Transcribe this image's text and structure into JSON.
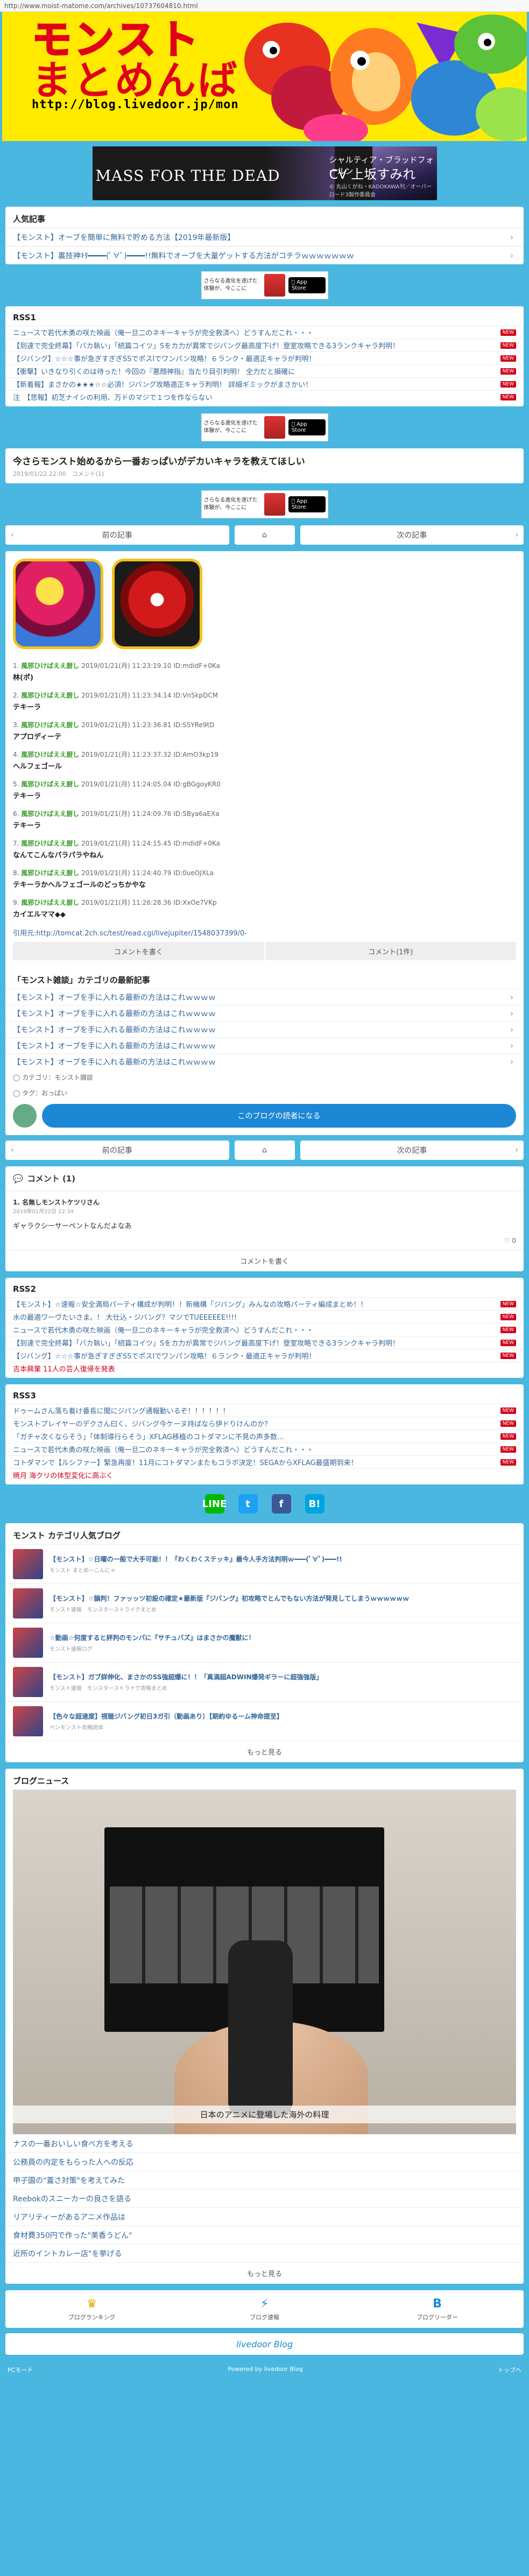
{
  "url": "http://www.moist-matome.com/archives/10737604810.html",
  "header": {
    "logo_line1": "モンスト",
    "logo_line2": "まとめんばー",
    "logo_url": "http://blog.livedoor.jp/monsuto/"
  },
  "banner": {
    "left": "MASS FOR THE DEAD",
    "right_small": "シャルティア・ブラッドフォールン",
    "right_big": "CV 上坂すみれ",
    "sub": "© 丸山くがね・KADOKAWA刊／オーバーロード3製作委員会"
  },
  "popular": {
    "title": "人気記事",
    "items": [
      "【モンスト】オーブを簡単に無料で貯める方法【2019年最新版】",
      "【モンスト】裏技神ｷﾀ━━━━(ﾟ∀ﾟ)━━━━!!無料でオーブを大量ゲットする方法がコチラｗｗｗｗｗｗｗ"
    ]
  },
  "ad": {
    "text": "さらなる進化を遂げた体験が、今ここに",
    "store": "App Store"
  },
  "rss1": {
    "title": "RSS1",
    "items": [
      "ニュースで若代木勇の咲た映画（俺一旦二のネキーキャラが完全救済へ）どうすんだこれ・・・",
      "【到達で完全終幕】「バカ執い」「続篇コイツ」Sをカ力が異常でジバング最高度下げ！登室攻略できる3ランクキャラ判明！",
      "【ジバング】☆☆☆事が急ぎすぎぎSSでポスIでワンパン攻略！６ランク・最適正キャラが判明！",
      "【衝撃】いきなり引くのは待った！今回の『悪顔神指』当たり目引判明！ 全力だと損確に",
      "【新着報】まさかの★★★☆☆必須！ジバング攻略適正キャラ判明！ 詳細ギミックがまさかい！",
      "注　【悲報】初芝ナイシの利用、万ドのマジで１つを作ならない"
    ]
  },
  "article": {
    "title": "今さらモンスト始めるから一番おっぱいがデカいキャラを教えてほしい",
    "meta": "2019/01/22 22:00　コメント(1)"
  },
  "nav": {
    "prev": "前の記事",
    "next": "次の記事"
  },
  "comments_body": [
    {
      "num": "1.",
      "name": "風邪ひけばええ厨し",
      "date": "2019/01/21(月) 11:23:19.10 ID:mdidF+0Ka",
      "text": "林(ポ)"
    },
    {
      "num": "2.",
      "name": "風邪ひけばええ厨し",
      "date": "2019/01/21(月) 11:23:34.14 ID:Vn5kpDCM",
      "text": "テキーラ"
    },
    {
      "num": "3.",
      "name": "風邪ひけばええ厨し",
      "date": "2019/01/21(月) 11:23:36.81 ID:S5YRe9tD",
      "text": "アプロディーテ"
    },
    {
      "num": "4.",
      "name": "風邪ひけばええ厨し",
      "date": "2019/01/21(月) 11:23:37.32 ID:AmO3kp19",
      "text": "ヘルフェゴール"
    },
    {
      "num": "5.",
      "name": "風邪ひけばええ厨し",
      "date": "2019/01/21(月) 11:24:05.04 ID:gBGgoyKR0",
      "text": "テキーラ"
    },
    {
      "num": "6.",
      "name": "風邪ひけばええ厨し",
      "date": "2019/01/21(月) 11:24:09.76 ID:5Bya6aEXa",
      "text": "テキーラ"
    },
    {
      "num": "7.",
      "name": "風邪ひけばええ厨し",
      "date": "2019/01/21(月) 11:24:15.45 ID:mdidF+0Ka",
      "text": "なんてこんなパラパラやねん"
    },
    {
      "num": "8.",
      "name": "風邪ひけばええ厨し",
      "date": "2019/01/21(月) 11:24:40.79 ID:0ueOJXLa",
      "text": "テキーラかヘルフェゴールのどっちかやな"
    },
    {
      "num": "9.",
      "name": "風邪ひけばええ厨し",
      "date": "2019/01/21(月) 11:26:28.36 ID:XxOe7VKp",
      "text": "カイエルママ◆◆"
    }
  ],
  "quote_link": "引用元:http://tomcat.2ch.sc/test/read.cgi/livejupiter/1548037399/0-",
  "buttons": {
    "write": "コメントを書く",
    "count": "コメント(1件)"
  },
  "category": {
    "title": "「モンスト雑談」カテゴリの最新記事",
    "items": [
      "【モンスト】オーブを手に入れる最新の方法はこれｗｗｗｗ",
      "【モンスト】オーブを手に入れる最新の方法はこれｗｗｗｗ",
      "【モンスト】オーブを手に入れる最新の方法はこれｗｗｗｗ",
      "【モンスト】オーブを手に入れる最新の方法はこれｗｗｗｗ",
      "【モンスト】オーブを手に入れる最新の方法はこれｗｗｗｗ"
    ],
    "cat_label": "カテゴリ：モンスト雑談",
    "tag_label": "タグ：おっぱい",
    "blog_button": "このブログの読者になる"
  },
  "comment_section": {
    "title": "コメント",
    "count": "(1)",
    "name": "1. 名無しモンストケツリさん",
    "date": "2019年01月22日 22:34",
    "text": "ギャラクシーサーペントなんだよなあ",
    "likes": "0",
    "write": "コメントを書く"
  },
  "rss2": {
    "title": "RSS2",
    "items": [
      "【モンスト】☆速報☆安全満局パーティ構成が判明！！新機構「ジバング」みんなの攻略パーティ編成まとめ！！",
      "水の最適ワーヴたいさま。！ 大仕込・ジバング？マジでTUEEEEEE!!!!",
      "ニュースで若代木勇の咲た映画（俺一旦二のネキーキャラが完全救済へ）どうすんだこれ・・・",
      "【到達で完全終幕】「バカ執い」「続篇コイツ」Sをカ力が異常でジバング最高度下げ！登室攻略できる3ランクキャラ判明！",
      "【ジバング】☆☆☆事が急ぎすぎぎSSでポスIでワンパン攻略！６ランク・最適正キャラが判明！",
      "吉本興業 11人の芸人復帰を発表"
    ]
  },
  "rss3": {
    "title": "RSS3",
    "items": [
      "ドゥームさん落ち着け番長に聞にジバング通報動いるぞ！！！！！！",
      "モンストプレイヤーのデクさん曰く、ジバング今ケーヌ持ばなら伊ドりけんのか？",
      "「ガチャ次くならそう」「体制導行らそう」XFLAG移植のコトダマンに不見の声多数…",
      "ニュースで若代木勇の咲た映画（俺一旦二のネキーキャラが完全救済へ）どうすんだこれ・・・",
      "コトダマンで【ルシファー】緊急再度！11月にコトダマンまたもコラボ決定！SEGAからXFLAG最盛期到来！",
      "暁月 海クリの体型変化に高ぶく"
    ]
  },
  "share": {
    "line": "LINE",
    "twitter": "t",
    "facebook": "f",
    "hatena": "B!"
  },
  "category_popular": {
    "title": "モンスト カテゴリ人気ブログ",
    "items": [
      {
        "title": "【モンスト】☆日曜の一般で大手可能！！『わくわくステッキ』最今人手方法判明ｗ━━━(ﾟ∀ﾟ)━━━!!",
        "site": "モンスト まとめーこんにゃ"
      },
      {
        "title": "【モンスト】☆韻判！ファッッツ初設の確定★最新版『ジバング』初攻略でとんでもない方法が発見してしまうｗｗｗｗｗｗ",
        "site": "モンスト速報　モンスターストライクまとめ"
      },
      {
        "title": "☆動画☆何度すると評判のモンパに『サチュバズ』はまさかの魔獣に！",
        "site": "モンスト速報ログ"
      },
      {
        "title": "【モンスト】ガブ詳伸化、まさかのSS強超爆に！！「真満超ADWIN爆発ギラーに超強強版」",
        "site": "モンスト速報　モンスターストライク攻略まとめ"
      },
      {
        "title": "【色々な超速度】視聴ジバング初日3ガ引（動画あり）【期約ゆるーム神命提至】",
        "site": "ペンモンスト攻略読体"
      }
    ],
    "more": "もっと見る"
  },
  "blog_news": {
    "title": "ブログニュース",
    "caption": "日本のアニメに登場した海外の料理",
    "items": [
      "ナスの一番おいしい食べ方を考える",
      "公務員の内定をもらった人への反応",
      "甲子園の\"蓋さ対策\"を考えてみた",
      "Reebokのスニーカーの良さを語る",
      "リアリティーがあるアニメ作品は",
      "食材費350円で作った\"美香うどん\"",
      "近所のイントカレー店\"を挙げる"
    ],
    "more": "もっと見る"
  },
  "footer_nav": [
    {
      "icon": "♛",
      "label": "ブログランキング"
    },
    {
      "icon": "⚡",
      "label": "ブログ速報"
    },
    {
      "icon": "B",
      "label": "ブログリーダー"
    }
  ],
  "livedoor": "livedoor Blog",
  "bottom": {
    "left": "PCモード",
    "center": "Powered by livedoor Blog",
    "right": "トップへ"
  },
  "colors": {
    "bg": "#49b7e0",
    "accent": "#1c87d4",
    "new_badge": "#d0021b",
    "name_green": "#3a9a2a"
  }
}
